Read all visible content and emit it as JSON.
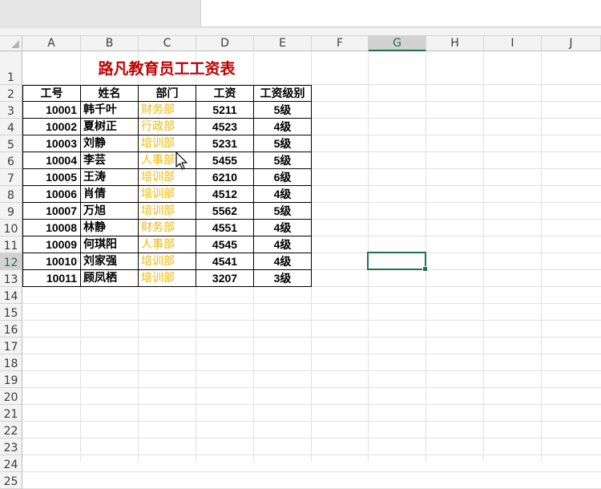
{
  "columns": [
    "A",
    "B",
    "C",
    "D",
    "E",
    "F",
    "G",
    "H",
    "I",
    "J"
  ],
  "selected_column": "G",
  "selected_row": "12",
  "rows": [
    "1",
    "2",
    "3",
    "4",
    "5",
    "6",
    "7",
    "8",
    "9",
    "10",
    "11",
    "12",
    "13",
    "14",
    "15",
    "16",
    "17",
    "18",
    "19",
    "20",
    "21",
    "22",
    "23",
    "24",
    "25"
  ],
  "sheet": {
    "title": "路凡教育员工工资表",
    "headers": [
      "工号",
      "姓名",
      "部门",
      "工资",
      "工资级别"
    ],
    "records": [
      [
        "10001",
        "韩千叶",
        "财务部",
        "5211",
        "5级"
      ],
      [
        "10002",
        "夏树正",
        "行政部",
        "4523",
        "4级"
      ],
      [
        "10003",
        "刘静",
        "培训部",
        "5231",
        "5级"
      ],
      [
        "10004",
        "李芸",
        "人事部",
        "5455",
        "5级"
      ],
      [
        "10005",
        "王涛",
        "培训部",
        "6210",
        "6级"
      ],
      [
        "10006",
        "肖倩",
        "培训部",
        "4512",
        "4级"
      ],
      [
        "10007",
        "万旭",
        "培训部",
        "5562",
        "5级"
      ],
      [
        "10008",
        "林静",
        "财务部",
        "4551",
        "4级"
      ],
      [
        "10009",
        "何琪阳",
        "人事部",
        "4545",
        "4级"
      ],
      [
        "10010",
        "刘家强",
        "培训部",
        "4541",
        "4级"
      ],
      [
        "10011",
        "顾凤栖",
        "培训部",
        "3207",
        "3级"
      ]
    ]
  },
  "colors": {
    "title": "#c00000",
    "department": "#f5b800",
    "selection": "#217346"
  },
  "icons": {
    "cursor": "mouse-pointer-icon",
    "corner": "select-all-icon"
  }
}
